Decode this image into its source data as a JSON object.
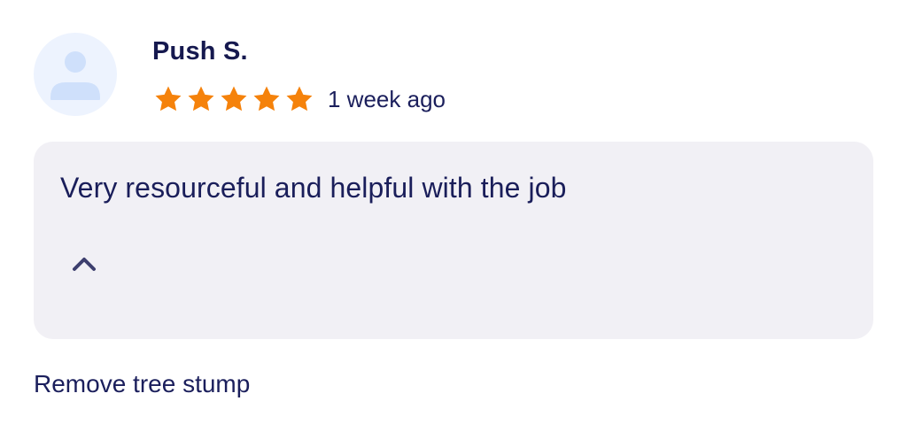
{
  "review": {
    "reviewer_name": "Push S.",
    "rating": 5,
    "rating_max": 5,
    "time_ago": "1 week ago",
    "comment": "Very resourceful and helpful with the job",
    "service": "Remove tree stump"
  },
  "icons": {
    "avatar": "user-placeholder-icon",
    "star": "star-icon",
    "collapse": "chevron-up-icon"
  },
  "colors": {
    "star": "#f5820b",
    "text": "#1b1f5c",
    "card_background": "#f1f0f5",
    "avatar_background": "#edf3fe",
    "avatar_figure": "#cfe0fb"
  }
}
